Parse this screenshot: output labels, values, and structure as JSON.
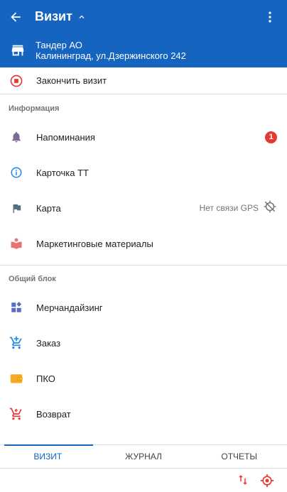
{
  "appbar": {
    "title": "Визит",
    "colors": {
      "primary": "#1565c0",
      "on_primary": "#ffffff"
    },
    "icons": {
      "back": "arrow-back-icon",
      "expand": "chevron-up-icon",
      "more": "more-vert-icon"
    }
  },
  "store": {
    "name": "Тандер АО",
    "address": "Калининград, ул.Дзержинского 242",
    "icon": "store-icon"
  },
  "finish_visit": {
    "label": "Закончить визит",
    "icon": "stop-circle-icon",
    "color": "#e53935"
  },
  "sections": {
    "info": {
      "title": "Информация",
      "items": [
        {
          "label": "Напоминания",
          "icon": "bell-icon",
          "badge": "1"
        },
        {
          "label": "Карточка ТТ",
          "icon": "info-icon"
        },
        {
          "label": "Карта",
          "icon": "flag-icon",
          "status": "Нет связи GPS",
          "status_icon": "gps-off-icon"
        },
        {
          "label": "Маркетинговые материалы",
          "icon": "book-icon"
        }
      ]
    },
    "common": {
      "title": "Общий блок",
      "items": [
        {
          "label": "Мерчандайзинг",
          "icon": "widgets-icon"
        },
        {
          "label": "Заказ",
          "icon": "cart-add-icon"
        },
        {
          "label": "ПКО",
          "icon": "wallet-icon"
        },
        {
          "label": "Возврат",
          "icon": "cart-return-icon"
        }
      ]
    }
  },
  "tabs": [
    {
      "label": "ВИЗИТ",
      "active": true
    },
    {
      "label": "ЖУРНАЛ",
      "active": false
    },
    {
      "label": "ОТЧЕТЫ",
      "active": false
    }
  ],
  "bottom_tools": {
    "sort_icon": "sort-icon",
    "target_icon": "target-icon",
    "color": "#e53935"
  }
}
